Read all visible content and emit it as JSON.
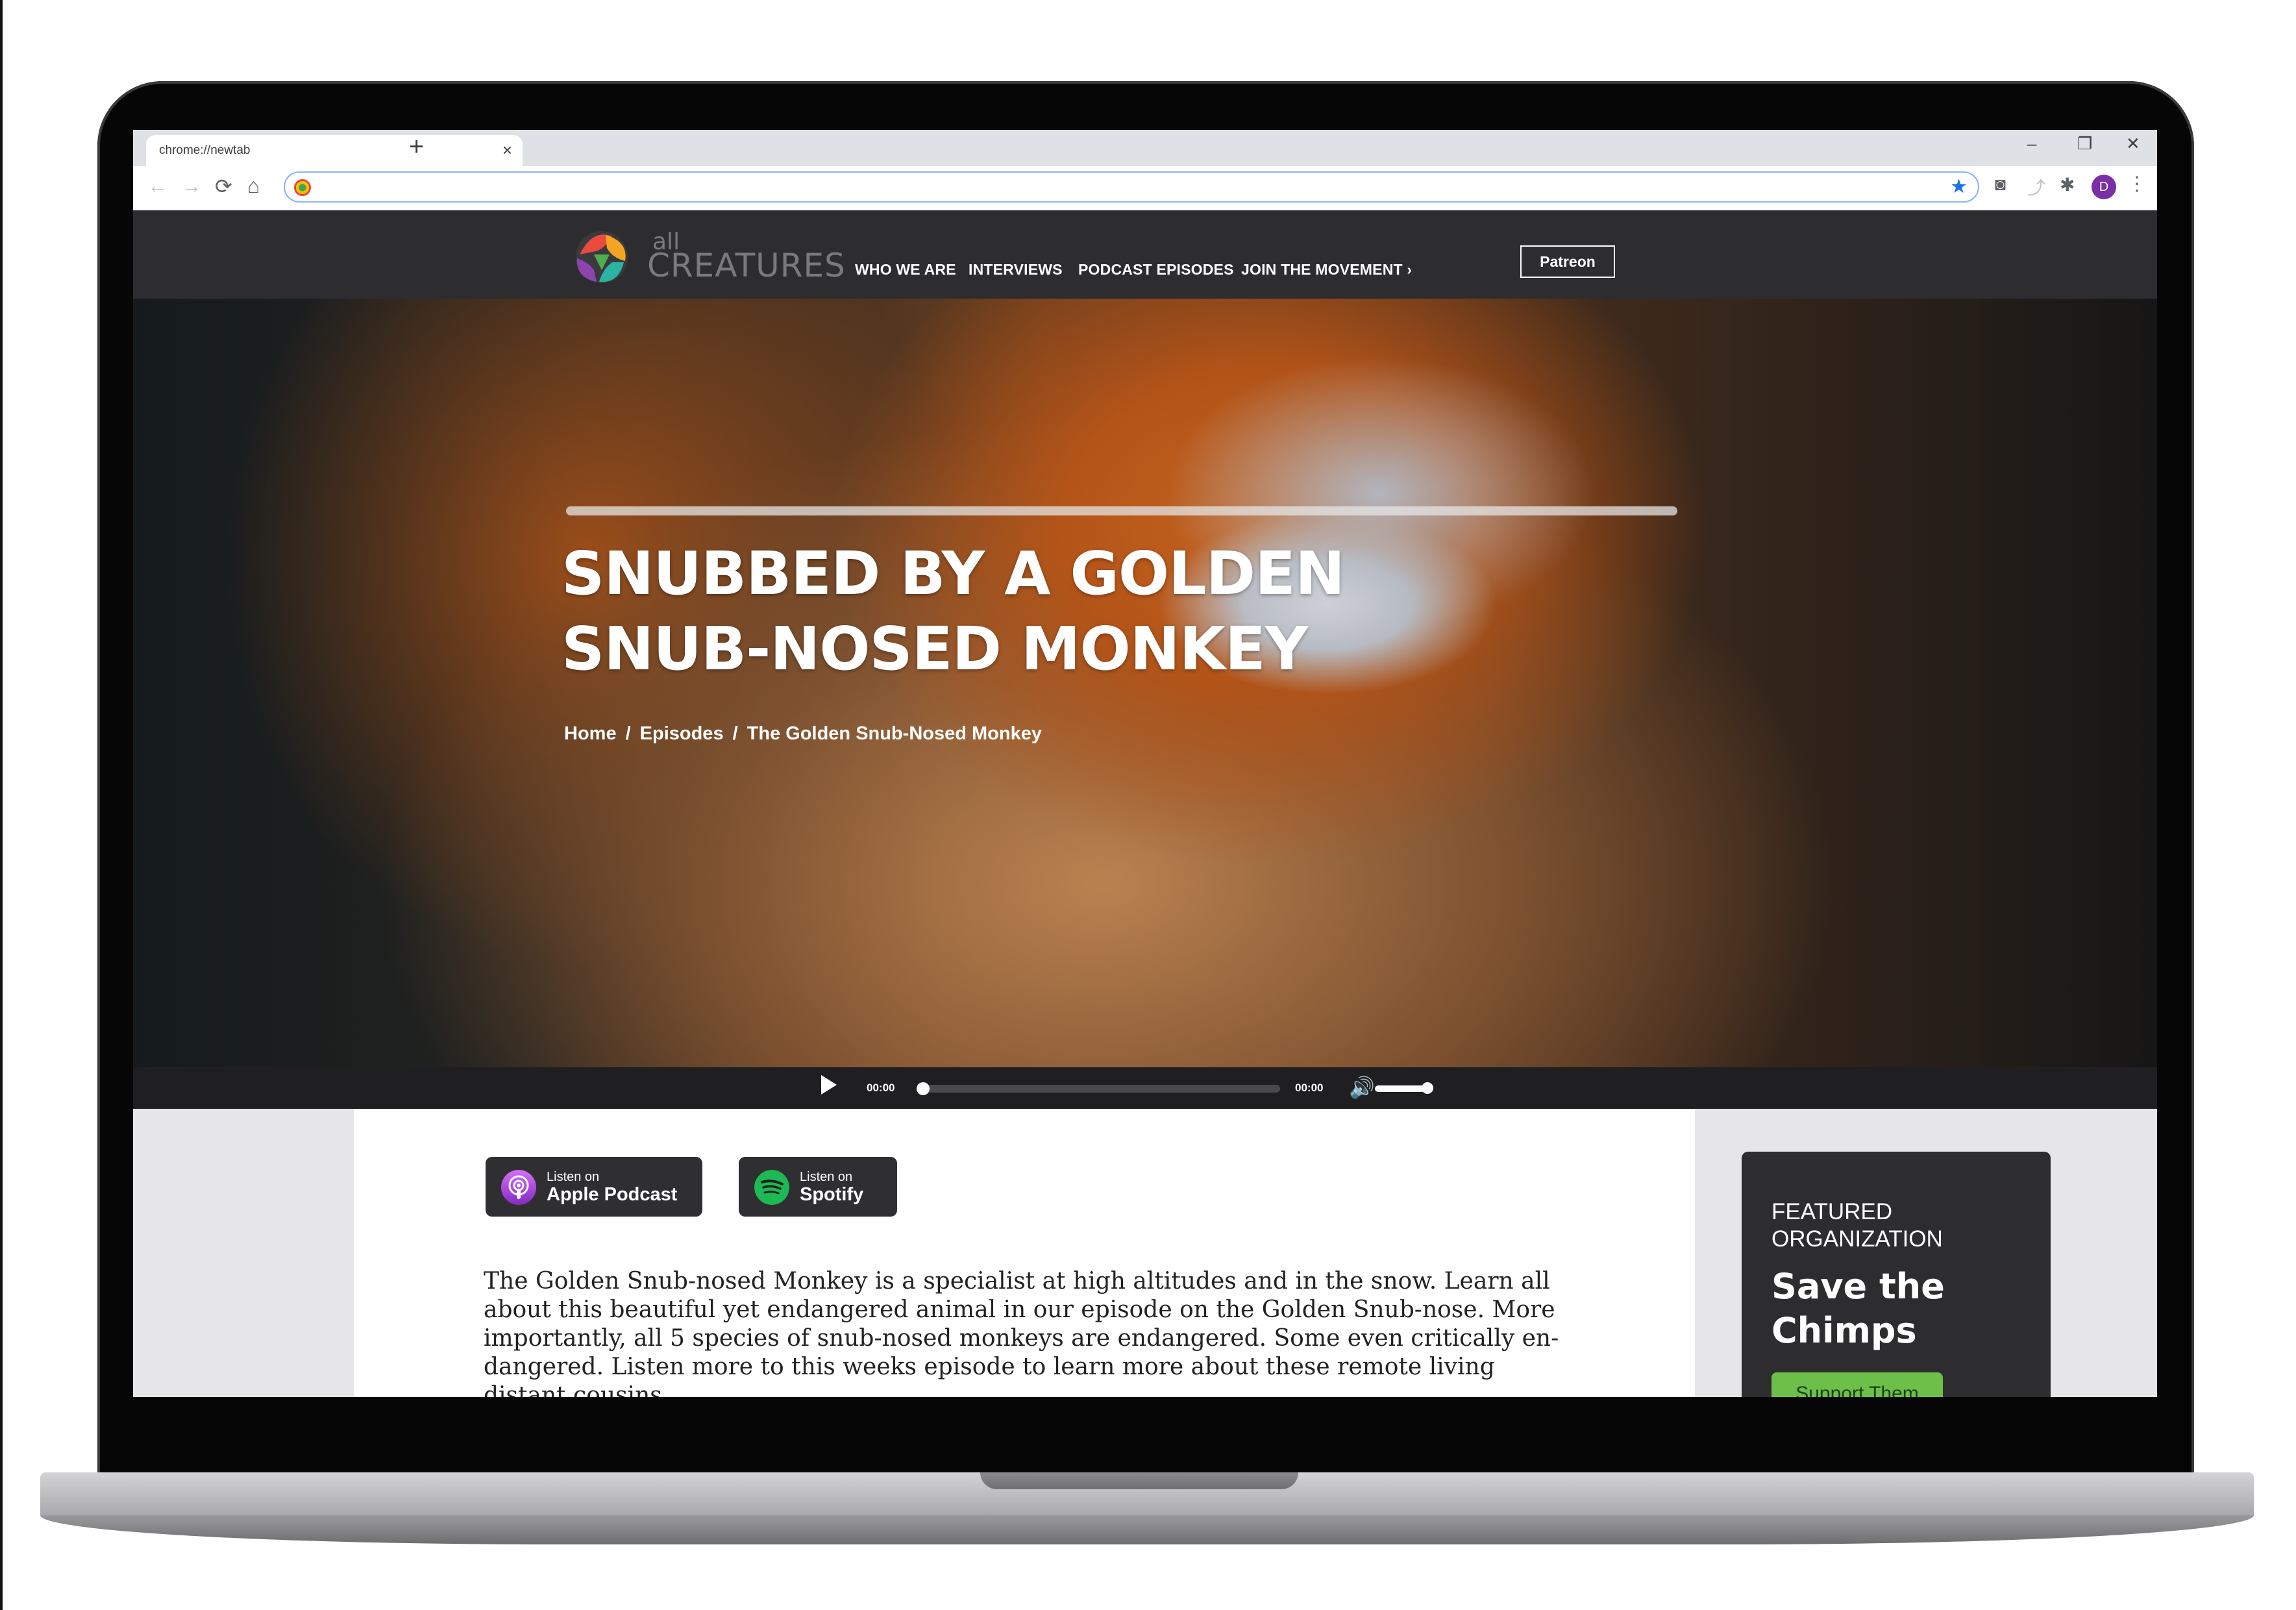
{
  "browser": {
    "tab_title": "chrome://newtab",
    "tab_close": "×",
    "new_tab": "+",
    "window_minimize": "–",
    "window_restore": "❐",
    "window_close": "✕",
    "back": "←",
    "forward": "→",
    "reload": "⟳",
    "home": "⌂",
    "address_value": "",
    "bookmark_star": "★",
    "ext_pocket": "◙",
    "ext_arrow": "⤴",
    "ext_puzzle": "✱",
    "profile_initial": "D",
    "menu": "⋮"
  },
  "site": {
    "logo_small": "all",
    "logo_big": "CREATURES",
    "nav": [
      "WHO WE ARE",
      "INTERVIEWS",
      "PODCAST EPISODES",
      "JOIN THE MOVEMENT ›"
    ],
    "patreon": "Patreon"
  },
  "hero": {
    "title_line1": "SNUBBED BY A GOLDEN",
    "title_line2": "SNUB-NOSED MONKEY",
    "breadcrumb": [
      "Home",
      "Episodes",
      "The Golden Snub-Nosed Monkey"
    ],
    "breadcrumb_sep": "/"
  },
  "player": {
    "current_time": "00:00",
    "duration": "00:00",
    "progress": 0,
    "volume": 1.0,
    "volume_icon": "🔊"
  },
  "listen": {
    "apple_small": "Listen on",
    "apple_big": "Apple Podcast",
    "spotify_small": "Listen on",
    "spotify_big": "Spotify"
  },
  "article": {
    "body": "The Golden Snub-nosed Monkey is a specialist at high altitudes and in the snow. Learn all about this beautiful yet endangered animal in our episode on the Golden Snub-nose. More importantly, all 5 species of snub-nosed monkeys are endangered. Some even critically en-dangered. Listen more to this weeks episode to learn more about these remote living distant cousins."
  },
  "sidebar": {
    "label": "FEATURED ORGANIZATION",
    "title": "Save the Chimps",
    "button": "Support Them"
  },
  "colors": {
    "header_bg": "#2d2d30",
    "support_green": "#6cc04a",
    "hero_orange": "#c05a1a"
  }
}
